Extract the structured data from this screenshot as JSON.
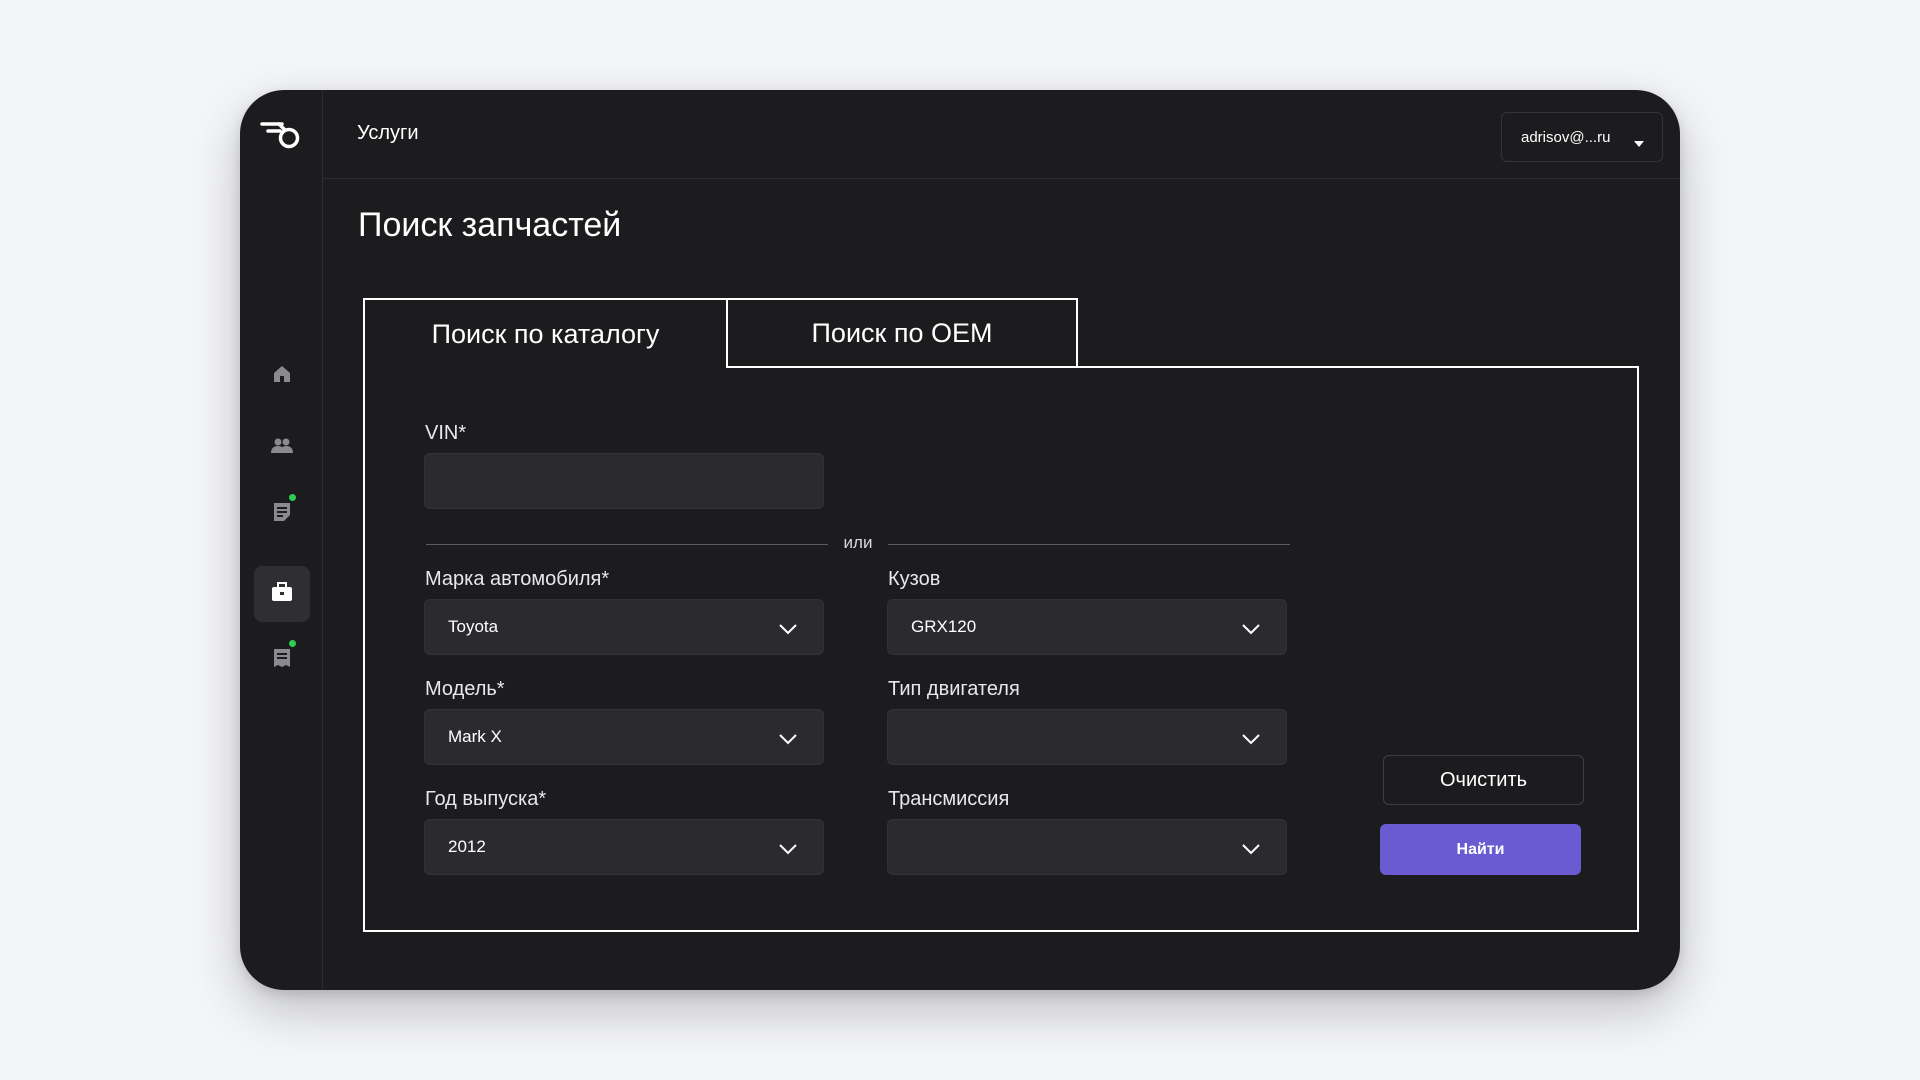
{
  "header": {
    "section_title": "Услуги",
    "user_email": "adrisov@...ru"
  },
  "sidebar": {
    "items": [
      {
        "name": "home",
        "icon": "home-icon",
        "active": false,
        "badge": false
      },
      {
        "name": "clients",
        "icon": "users-icon",
        "active": false,
        "badge": false
      },
      {
        "name": "orders",
        "icon": "document-icon",
        "active": false,
        "badge": true
      },
      {
        "name": "parts",
        "icon": "briefcase-icon",
        "active": true,
        "badge": false
      },
      {
        "name": "reports",
        "icon": "receipt-icon",
        "active": false,
        "badge": true
      }
    ]
  },
  "page": {
    "title": "Поиск запчастей"
  },
  "tabs": [
    {
      "label": "Поиск по каталогу",
      "active": true
    },
    {
      "label": "Поиск по OEM",
      "active": false
    }
  ],
  "form": {
    "vin": {
      "label": "VIN*",
      "value": ""
    },
    "separator": "или",
    "brand": {
      "label": "Марка автомобиля*",
      "value": "Toyota"
    },
    "body": {
      "label": "Кузов",
      "value": "GRX120"
    },
    "model": {
      "label": "Модель*",
      "value": "Mark X"
    },
    "engine": {
      "label": "Тип двигателя",
      "value": ""
    },
    "year": {
      "label": "Год выпуска*",
      "value": "2012"
    },
    "transmission": {
      "label": "Трансмиссия",
      "value": ""
    }
  },
  "actions": {
    "clear_label": "Очистить",
    "find_label": "Найти"
  },
  "colors": {
    "app_bg": "#1c1c1e",
    "page_bg": "#f4f5f7",
    "accent": "#6b5bd2",
    "badge": "#2ecc52",
    "field_bg": "#2b2b2f"
  }
}
